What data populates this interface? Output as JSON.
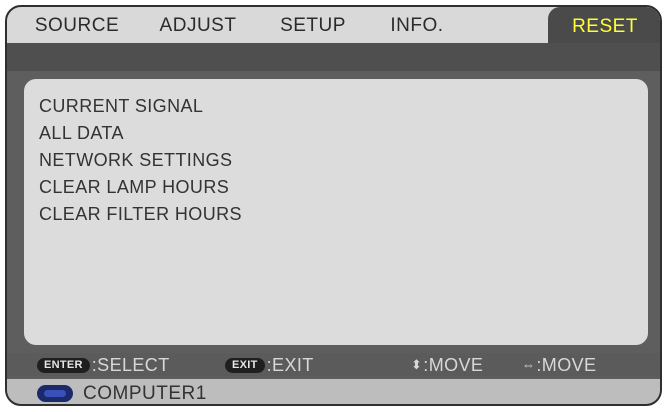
{
  "tabs": [
    {
      "label": "SOURCE"
    },
    {
      "label": "ADJUST"
    },
    {
      "label": "SETUP"
    },
    {
      "label": "INFO."
    },
    {
      "label": "RESET"
    }
  ],
  "active_tab": "RESET",
  "menu": {
    "items": [
      {
        "label": "CURRENT SIGNAL"
      },
      {
        "label": "ALL DATA"
      },
      {
        "label": "NETWORK SETTINGS"
      },
      {
        "label": "CLEAR LAMP HOURS"
      },
      {
        "label": "CLEAR FILTER HOURS"
      }
    ]
  },
  "help": {
    "enter_key": "ENTER",
    "select": ":SELECT",
    "exit_key": "EXIT",
    "exit": ":EXIT",
    "updown_glyph": "⬍",
    "move_vertical": ":MOVE",
    "leftright_glyph": "⇔",
    "move_horizontal": ":MOVE"
  },
  "status": {
    "source_icon": "computer-input-icon",
    "source_label": "COMPUTER1"
  },
  "colors": {
    "active_tab_text": "#ffff33",
    "tab_bar": "#d9d9d9",
    "content_bg": "#dcdcdc",
    "frame": "#5e5e5e"
  }
}
